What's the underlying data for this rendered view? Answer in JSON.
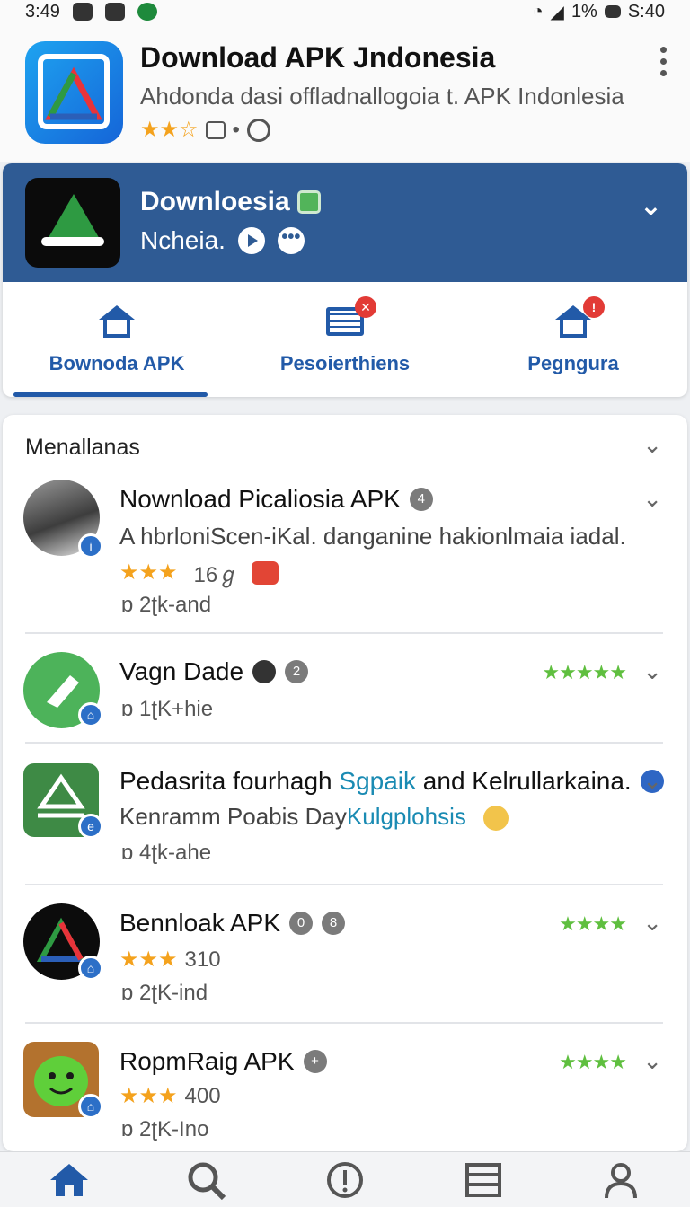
{
  "status_bar": {
    "time": "3:49",
    "battery": "1%",
    "clock_right": "S:40"
  },
  "app": {
    "title": "Download APK Jndonesia",
    "subtitle": "Ahdonda dasi offladnallogoia t. APK Indonlesia",
    "rating_stars": "★★☆",
    "meta_dot": "•"
  },
  "banner": {
    "title": "Downloesia",
    "subtitle": "Ncheia."
  },
  "tabs": [
    {
      "label": "Bownoda APK"
    },
    {
      "label": "Pesoierthiens"
    },
    {
      "label": "Pegngura"
    }
  ],
  "list": {
    "header": "Menallanas",
    "items": [
      {
        "title": "Nownload Picaliosia APK",
        "badge": "4",
        "desc": "A hbrloniScen-iKal. danganine hakionlmaia iadal.",
        "stars": "★★★",
        "rating_count": "16ℊ",
        "downloads": "2ʈk-and"
      },
      {
        "title": "Vagn Dade",
        "badge": "2",
        "downloads": "1ʈK+hie",
        "green_stars": "★★★★★"
      },
      {
        "title_prefix": "Pedasrita fourhagh ",
        "title_accent": "Sgpaik",
        "title_suffix": " and Kelrullarkaina.",
        "desc_prefix": "Kenramm Poabis Day",
        "desc_accent": "Kulgplohsis",
        "downloads": "4ʈk-ahe"
      },
      {
        "title": "Bennloak APK",
        "badge": "0",
        "badge2": "8",
        "stars": "★★★",
        "rating_count": "310",
        "downloads": "2ʈK-ind",
        "green_stars": "★★★★"
      },
      {
        "title": "RopmRaig APK",
        "badge": "+",
        "stars": "★★★",
        "rating_count": "400",
        "downloads": "2ʈK-Ino",
        "green_stars": "★★★★"
      }
    ]
  },
  "chevron": "⌄",
  "dl_icon": "ɒ",
  "bottom_nav": [
    {
      "name": "home-icon"
    },
    {
      "name": "search-icon"
    },
    {
      "name": "info-icon"
    },
    {
      "name": "list-icon"
    },
    {
      "name": "profile-icon"
    }
  ]
}
